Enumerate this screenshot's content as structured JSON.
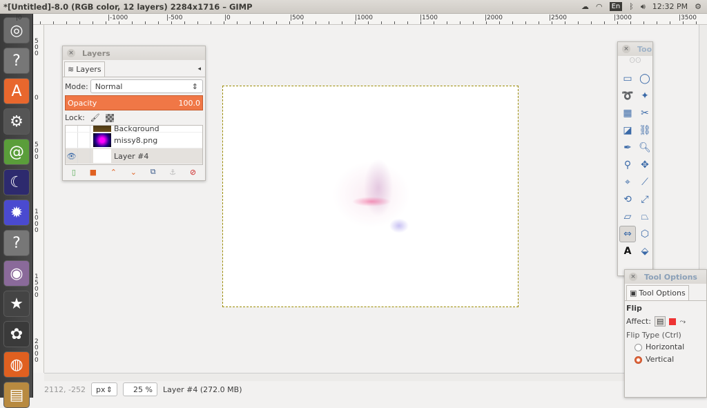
{
  "window": {
    "title": "*[Untitled]-8.0 (RGB color, 12 layers) 2284x1716 – GIMP"
  },
  "tray": {
    "cloud_icon": "cloud-icon",
    "wifi_icon": "wifi-icon",
    "keyboard": "En",
    "bluetooth_icon": "bluetooth-icon",
    "volume_icon": "volume-icon",
    "time": "12:32 PM",
    "power_icon": "gear-power-icon"
  },
  "launcher": {
    "items": [
      {
        "name": "ubuntu-dash",
        "glyph": "◎",
        "color": "#6d6d6d"
      },
      {
        "name": "unknown-app",
        "glyph": "?",
        "color": "#777"
      },
      {
        "name": "software-center",
        "glyph": "A",
        "color": "#e8672d"
      },
      {
        "name": "system-settings",
        "glyph": "⚙",
        "color": "#555"
      },
      {
        "name": "fractal-app",
        "glyph": "@",
        "color": "#5a9e3a"
      },
      {
        "name": "stellarium",
        "glyph": "☾",
        "color": "#2d2a6e"
      },
      {
        "name": "mandelbrot-app",
        "glyph": "✹",
        "color": "#4a4ad0"
      },
      {
        "name": "unknown-app-2",
        "glyph": "?",
        "color": "#777"
      },
      {
        "name": "cheese-webcam",
        "glyph": "◉",
        "color": "#8a6a9a"
      },
      {
        "name": "xfavorites",
        "glyph": "★",
        "color": "#444"
      },
      {
        "name": "turtle-app",
        "glyph": "✿",
        "color": "#3a3a3a"
      },
      {
        "name": "firefox",
        "glyph": "◍",
        "color": "#e06020"
      },
      {
        "name": "image-viewer",
        "glyph": "▤",
        "color": "#b88a40"
      }
    ]
  },
  "ruler_h": {
    "labels": [
      "0",
      "-1000",
      "-500",
      "0",
      "500",
      "1000",
      "1500",
      "2000",
      "2500",
      "3000",
      "3500"
    ]
  },
  "ruler_v": {
    "labels": [
      "500",
      "0",
      "500",
      "1000",
      "1500",
      "2000"
    ]
  },
  "layers_panel": {
    "title": "Layers",
    "tab_label": "Layers",
    "mode_label": "Mode:",
    "mode_value": "Normal",
    "opacity_label": "Opacity",
    "opacity_value": "100.0",
    "lock_label": "Lock:",
    "layers": [
      {
        "name": "Background",
        "visible": false
      },
      {
        "name": "missy8.png",
        "visible": false
      },
      {
        "name": "Layer #4",
        "visible": true,
        "selected": true
      }
    ],
    "buttons": [
      "new-layer",
      "new-layer-group",
      "raise-layer",
      "lower-layer",
      "duplicate-layer",
      "anchor-layer",
      "delete-layer"
    ]
  },
  "toolbox": {
    "title": "Toolbox",
    "title_visible": "Too",
    "tools": [
      "rect-select",
      "ellipse-select",
      "free-select",
      "fuzzy-select",
      "select-by-color",
      "scissors-select",
      "foreground-select",
      "paths",
      "color-picker",
      "zoom",
      "measure",
      "move",
      "align",
      "crop",
      "rotate",
      "scale",
      "shear",
      "perspective",
      "flip",
      "cage-transform",
      "text",
      "bucket-fill"
    ],
    "active_tool": "flip"
  },
  "tool_options": {
    "title": "Tool Options",
    "tab_label": "Tool Options",
    "tool_name": "Flip",
    "affect_label": "Affect:",
    "flip_type_label": "Flip Type  (Ctrl)",
    "options": [
      {
        "label": "Horizontal",
        "selected": false
      },
      {
        "label": "Vertical",
        "selected": true
      }
    ]
  },
  "status": {
    "coords": "2112, -252",
    "unit": "px",
    "zoom": "25 %",
    "layer_info": "Layer #4 (272.0 MB)"
  }
}
